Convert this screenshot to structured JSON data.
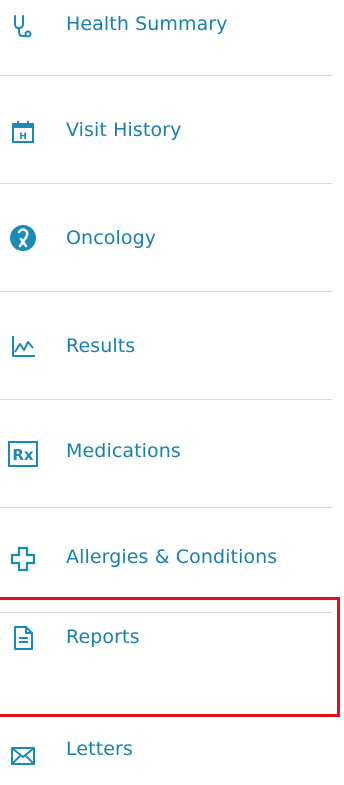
{
  "nav": {
    "items": [
      {
        "label": "Health Summary",
        "icon": "stethoscope-icon"
      },
      {
        "label": "Visit History",
        "icon": "calendar-icon"
      },
      {
        "label": "Oncology",
        "icon": "ribbon-icon"
      },
      {
        "label": "Results",
        "icon": "line-chart-icon"
      },
      {
        "label": "Medications",
        "icon": "rx-icon"
      },
      {
        "label": "Allergies & Conditions",
        "icon": "medical-cross-icon"
      },
      {
        "label": "Reports",
        "icon": "document-icon"
      },
      {
        "label": "Letters",
        "icon": "envelope-icon"
      }
    ],
    "rx_text": "Rx",
    "calendar_text": "H"
  },
  "colors": {
    "accent": "#1680b0",
    "divider": "#d6dee3",
    "highlight": "#e0101a"
  }
}
